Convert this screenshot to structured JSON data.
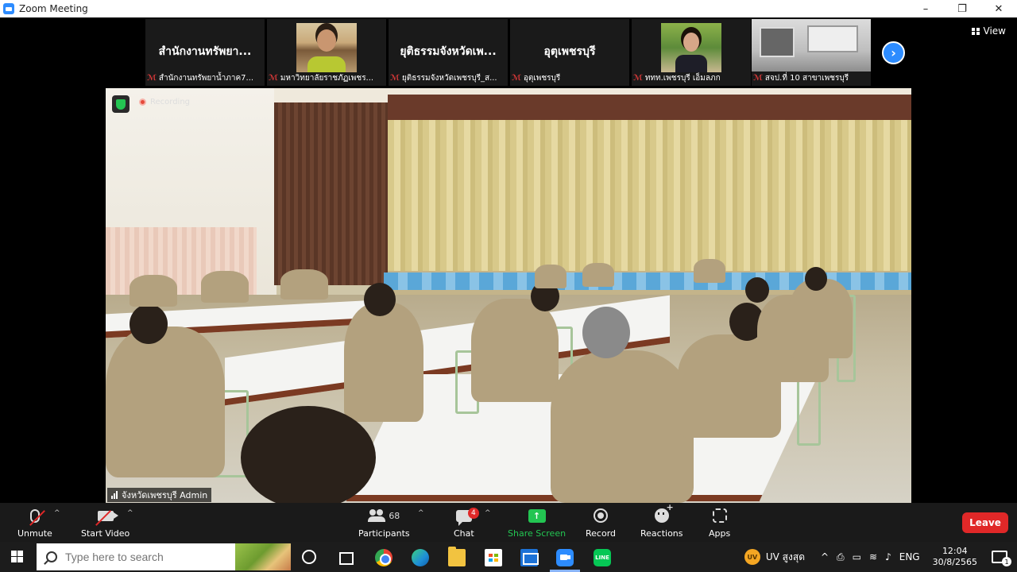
{
  "window": {
    "title": "Zoom Meeting",
    "minimize": "–",
    "restore": "❐",
    "close": "✕"
  },
  "thumbnails": [
    {
      "big_name": "สำนักงานทรัพยา...",
      "caption": "สำนักงานทรัพยาน้ำภาค7...",
      "photo": ""
    },
    {
      "big_name": "",
      "caption": "มหาวิทยาลัยราชภัฏเพชร...",
      "photo": "man"
    },
    {
      "big_name": "ยุติธรรมจังหวัดเพ...",
      "caption": "ยุติธรรมจังหวัดเพชรบุรี_ส...",
      "photo": ""
    },
    {
      "big_name": "อุตุเพชรบุรี",
      "caption": "อุตุเพชรบุรี",
      "photo": ""
    },
    {
      "big_name": "",
      "caption": "ททท.เพชรบุรี เอ็มลภก",
      "photo": "woman"
    },
    {
      "big_name": "",
      "caption": "สจป.ที่ 10 สาขาเพชรบุรี",
      "photo": "van"
    }
  ],
  "view_button": "View",
  "next_icon": "›",
  "recording_label": "Recording",
  "main_video": {
    "speaker_label": "จังหวัดเพชรบุรี Admin"
  },
  "controls": {
    "unmute": "Unmute",
    "start_video": "Start Video",
    "participants": "Participants",
    "participant_count": "68",
    "chat": "Chat",
    "chat_badge": "4",
    "share_screen": "Share Screen",
    "share_arrow": "↑",
    "record": "Record",
    "reactions": "Reactions",
    "apps": "Apps",
    "leave": "Leave",
    "caret": "^"
  },
  "taskbar": {
    "search_placeholder": "Type here to search",
    "line_label": "LINE",
    "uv_icon": "UV",
    "uv_text": "UV สูงสุด",
    "tray_chevron": "^",
    "lang": "ENG",
    "time": "12:04",
    "date": "30/8/2565",
    "notif_count": "1"
  },
  "colors": {
    "accent": "#2d8cff",
    "leave": "#e02828",
    "share": "#23c552"
  }
}
